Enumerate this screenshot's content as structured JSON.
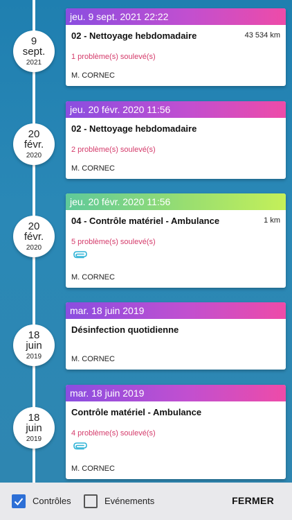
{
  "colors": {
    "accent_purple": "#8a4ee0",
    "accent_pink": "#ee4ba8",
    "accent_green": "#c4f059",
    "issue_text": "#d43a6a",
    "checkbox_blue": "#2d6fd6"
  },
  "entries": [
    {
      "date_day": "9",
      "date_month": "sept.",
      "date_year": "2021",
      "header": "jeu. 9 sept. 2021 22:22",
      "header_color": "purple",
      "title": "02 - Nettoyage hebdomadaire",
      "km": "43 534 km",
      "issues": "1 problème(s) soulevé(s)",
      "attachment_icon": "",
      "author": "M. CORNEC"
    },
    {
      "date_day": "20",
      "date_month": "févr.",
      "date_year": "2020",
      "header": "jeu. 20 févr. 2020 11:56",
      "header_color": "purple",
      "title": "02 - Nettoyage hebdomadaire",
      "km": "",
      "issues": "2 problème(s) soulevé(s)",
      "attachment_icon": "",
      "author": "M. CORNEC"
    },
    {
      "date_day": "20",
      "date_month": "févr.",
      "date_year": "2020",
      "header": "jeu. 20 févr. 2020 11:56",
      "header_color": "green",
      "title": "04 - Contrôle matériel - Ambulance",
      "km": "1 km",
      "issues": "5 problème(s) soulevé(s)",
      "attachment_icon": "paperclip-icon",
      "author": "M. CORNEC"
    },
    {
      "date_day": "18",
      "date_month": "juin",
      "date_year": "2019",
      "header": "mar. 18 juin 2019",
      "header_color": "purple",
      "title": "Désinfection quotidienne",
      "km": "",
      "issues": "",
      "attachment_icon": "",
      "author": "M. CORNEC"
    },
    {
      "date_day": "18",
      "date_month": "juin",
      "date_year": "2019",
      "header": "mar. 18 juin 2019",
      "header_color": "purple",
      "title": "Contrôle matériel - Ambulance",
      "km": "",
      "issues": "4 problème(s) soulevé(s)",
      "attachment_icon": "paperclip-icon",
      "author": "M. CORNEC"
    }
  ],
  "bottom_bar": {
    "controls_label": "Contrôles",
    "controls_checked": true,
    "events_label": "Evénements",
    "events_checked": false,
    "close_label": "FERMER"
  }
}
